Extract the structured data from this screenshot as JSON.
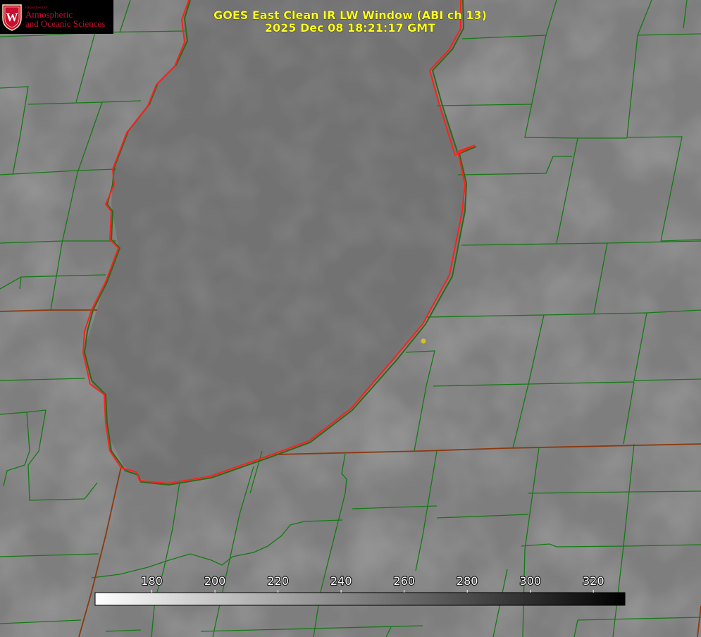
{
  "title": {
    "line1": "GOES East Clean IR LW Window (ABI ch 13)",
    "line2": "2025 Dec 08 18:21:17 GMT"
  },
  "logo": {
    "department": "Department of",
    "line1": "Atmospheric",
    "line2": "and Oceanic Sciences",
    "icon": "university-seal-icon",
    "seal_letter": "W"
  },
  "colorbar": {
    "ticks": [
      180,
      200,
      220,
      240,
      260,
      280,
      300,
      320
    ],
    "range": [
      162,
      330
    ],
    "palette": "white-to-black"
  },
  "colors": {
    "county_lines": "#157a15",
    "state_lines": "#8a3a10",
    "lake_outline": "#ff2020",
    "title_text": "#ffff22",
    "marker": "#d4c21a",
    "logo_text": "#c8102e"
  },
  "marker": {
    "icon": "location-dot-icon"
  }
}
